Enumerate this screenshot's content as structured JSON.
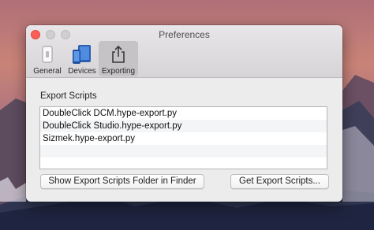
{
  "window": {
    "title": "Preferences"
  },
  "toolbar": {
    "items": [
      {
        "label": "General",
        "icon": "general-icon"
      },
      {
        "label": "Devices",
        "icon": "devices-icon"
      },
      {
        "label": "Exporting",
        "icon": "share-export-icon",
        "selected": true
      }
    ]
  },
  "export_scripts": {
    "section_label": "Export Scripts",
    "items": [
      "DoubleClick DCM.hype-export.py",
      "DoubleClick Studio.hype-export.py",
      "Sizmek.hype-export.py"
    ]
  },
  "buttons": {
    "show_folder": "Show Export Scripts Folder in Finder",
    "get_scripts": "Get Export Scripts..."
  },
  "colors": {
    "close_light": "#fc5f57",
    "selected_tab_bg": "#c5c3c5",
    "window_bg": "#ececec"
  }
}
